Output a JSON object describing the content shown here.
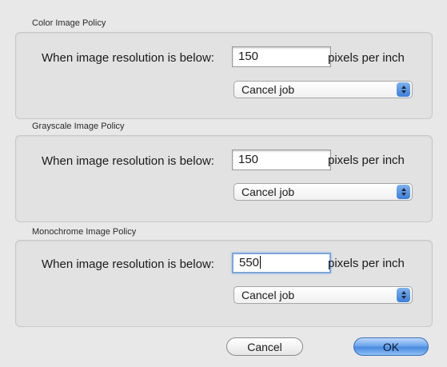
{
  "groups": [
    {
      "title": "Color Image Policy",
      "label": "When image resolution is below:",
      "value": "150",
      "unit": "pixels per inch",
      "action": "Cancel job"
    },
    {
      "title": "Grayscale Image Policy",
      "label": "When image resolution is below:",
      "value": "150",
      "unit": "pixels per inch",
      "action": "Cancel job"
    },
    {
      "title": "Monochrome Image Policy",
      "label": "When image resolution is below:",
      "value": "550",
      "unit": "pixels per inch",
      "action": "Cancel job"
    }
  ],
  "buttons": {
    "cancel": "Cancel",
    "ok": "OK"
  },
  "colors": {
    "ok_button": "#4a8ae0",
    "select_arrow": "#3d7fd6",
    "focus_ring": "#7fa6d8"
  },
  "icons": {
    "select_arrow": "up-down-arrows-icon"
  }
}
